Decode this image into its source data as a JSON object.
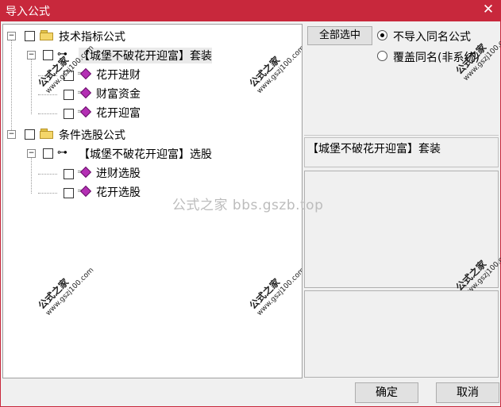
{
  "window": {
    "title": "导入公式",
    "close_glyph": "✕"
  },
  "tree": {
    "tech_group": "技术指标公式",
    "tech_package": "【城堡不破花开迎富】套装",
    "tech_items": [
      "花开进财",
      "财富资金",
      "花开迎富"
    ],
    "cond_group": "条件选股公式",
    "cond_package": "【城堡不破花开迎富】选股",
    "cond_items": [
      "进财选股",
      "花开选股"
    ]
  },
  "options": {
    "select_all_label": "全部选中",
    "radio_skip_label": "不导入同名公式",
    "radio_overwrite_label": "覆盖同名(非系统)",
    "selected_radio": "skip"
  },
  "info_text": "【城堡不破花开迎富】套装",
  "watermark": {
    "text": "公式之家 bbs.gszb.top",
    "stamp_top": "公式之家",
    "stamp_bottom": "www.gszj100.com"
  },
  "buttons": {
    "ok": "确定",
    "cancel": "取消"
  },
  "colors": {
    "titlebar": "#c8283c",
    "gem": "#b42fb4",
    "folder": "#f4d66a"
  }
}
